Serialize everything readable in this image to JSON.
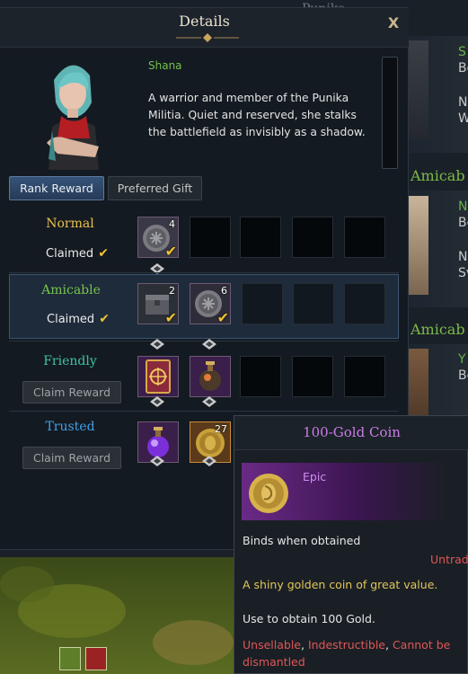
{
  "background": {
    "right_list": [
      {
        "title": "S",
        "line1": "Be",
        "line2": "N",
        "line3": "W"
      },
      {
        "title": "N",
        "line1": "Be",
        "line2": "N",
        "line3": "Sv"
      },
      {
        "title": "Y",
        "line1": "Be",
        "line2": "",
        "line3": ""
      }
    ],
    "right_rank_1": "Amicab",
    "right_rank_2": "Amicab",
    "top_label": "Punika"
  },
  "window": {
    "title": "Details",
    "close_glyph": "X"
  },
  "npc": {
    "name": "Shana",
    "description": "A warrior and member of the Punika Militia. Quiet and reserved, she stalks the battlefield as invisibly as a shadow."
  },
  "tabs": [
    {
      "label": "Rank Reward",
      "active": true
    },
    {
      "label": "Preferred Gift",
      "active": false
    }
  ],
  "ranks": [
    {
      "name": "Normal",
      "color": "#e8c24a",
      "status": "Claimed",
      "claimed": true,
      "rewards": [
        {
          "icon": "silver-coin-icon",
          "qty": "4",
          "claimed": true
        }
      ]
    },
    {
      "name": "Amicable",
      "color": "#76c44c",
      "status": "Claimed",
      "claimed": true,
      "selected": true,
      "rewards": [
        {
          "icon": "chest-icon",
          "qty": "2",
          "claimed": true
        },
        {
          "icon": "silver-coin-icon",
          "qty": "6",
          "claimed": true
        }
      ]
    },
    {
      "name": "Friendly",
      "color": "#3fc2a2",
      "status": "Claim Reward",
      "claimed": false,
      "rewards": [
        {
          "icon": "card-icon",
          "qty": "",
          "claimed": false
        },
        {
          "icon": "potion-bottle-icon",
          "qty": "",
          "claimed": false
        }
      ]
    },
    {
      "name": "Trusted",
      "color": "#3fa1e8",
      "status": "Claim Reward",
      "claimed": false,
      "rewards": [
        {
          "icon": "purple-potion-icon",
          "qty": "",
          "claimed": false
        },
        {
          "icon": "gold-coin-icon",
          "qty": "27",
          "claimed": false
        }
      ]
    }
  ],
  "tooltip": {
    "title": "100-Gold Coin",
    "grade": "Epic",
    "bind": "Binds when obtained",
    "untradable": "Untrad",
    "description": "A shiny golden coin of great value.",
    "use": "Use to obtain 100 Gold.",
    "flag_1": "Unsellable",
    "flag_2": "Indestructible",
    "flag_3": "Cannot be dismantled",
    "sep_1": ", ",
    "sep_2": ", ",
    "colors": {
      "title": "#c97ee6",
      "grade": "#cf8ff0",
      "desc": "#e0c65a",
      "warn": "#e05555"
    }
  }
}
